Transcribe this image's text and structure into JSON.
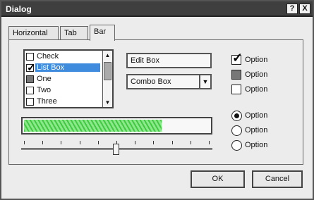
{
  "window": {
    "title": "Dialog",
    "help_label": "?",
    "close_label": "X"
  },
  "tabs": [
    {
      "label": "Horizontal"
    },
    {
      "label": "Tab"
    },
    {
      "label": "Bar",
      "active": true
    }
  ],
  "listbox": {
    "items": [
      {
        "label": "Check",
        "state": "unchecked"
      },
      {
        "label": "List Box",
        "state": "checked",
        "selected": true
      },
      {
        "label": "One",
        "state": "filled"
      },
      {
        "label": "Two",
        "state": "unchecked"
      },
      {
        "label": "Three",
        "state": "unchecked"
      }
    ],
    "scroll_up": "▲",
    "scroll_down": "▼"
  },
  "edit_box": {
    "value": "Edit Box"
  },
  "combo_box": {
    "value": "Combo Box",
    "arrow": "▼"
  },
  "checkbox_options": [
    {
      "label": "Option",
      "state": "checked"
    },
    {
      "label": "Option",
      "state": "filled"
    },
    {
      "label": "Option",
      "state": "unchecked"
    }
  ],
  "radio_options": [
    {
      "label": "Option",
      "selected": true
    },
    {
      "label": "Option",
      "selected": false
    },
    {
      "label": "Option",
      "selected": false
    }
  ],
  "progress": {
    "fraction": 0.74
  },
  "slider": {
    "fraction": 0.5,
    "tick_count": 11
  },
  "buttons": {
    "ok_label": "OK",
    "cancel_label": "Cancel"
  },
  "colors": {
    "selection": "#3f8bdd",
    "progress": "#5dd95d",
    "titlebar": "#3f3f3f"
  }
}
